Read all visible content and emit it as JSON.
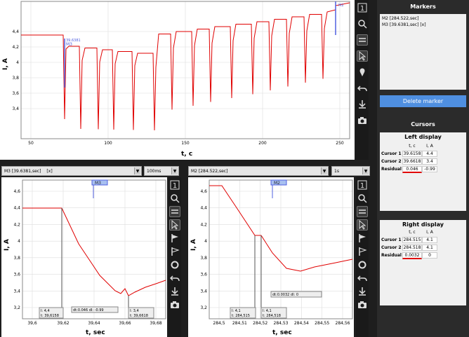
{
  "top_plot": {
    "ylabel": "I, A",
    "xlabel": "t, c",
    "yticks": [
      "4,4",
      "4,2",
      "4",
      "3,8",
      "3,6",
      "3,4"
    ],
    "xticks": [
      "50",
      "100",
      "150",
      "200",
      "250"
    ],
    "marker_labels": [
      "M3",
      "M2"
    ],
    "marker_values": [
      "39.6381",
      "284.522"
    ]
  },
  "bottom_left": {
    "select_marker": "M3 [39.6381,sec]",
    "select_x": "[x]",
    "select_window": "100ms",
    "ylabel": "I, A",
    "xlabel": "t, sec",
    "yticks": [
      "4,6",
      "4,4",
      "4,2",
      "4",
      "3,8",
      "3,6",
      "3,4",
      "3,2"
    ],
    "xticks": [
      "39,6",
      "39,62",
      "39,64",
      "39,66",
      "39,68"
    ],
    "marker_tag": "M3",
    "cursor1_text_i": "I:     4,4",
    "cursor1_text_t": "t:  39,6158",
    "cursor2_text_i": "I:     3,4",
    "cursor2_text_t": "t:  39,6618",
    "delta_text": "dt:0.046  dI:  -0.99"
  },
  "bottom_right": {
    "select_marker": "M2 [284.522,sec]",
    "select_window": "1s",
    "ylabel": "I, A",
    "xlabel": "t, sec",
    "yticks": [
      "4,6",
      "4,4",
      "4,2",
      "4",
      "3,8",
      "3,6",
      "3,4",
      "3,2"
    ],
    "xticks": [
      "284,5",
      "284,51",
      "284,52",
      "284,53",
      "284,54",
      "284,55",
      "284,56"
    ],
    "marker_tag": "M2",
    "cursor1_text_i": "I:     4,1",
    "cursor1_text_t": "t:  284,515",
    "cursor2_text_i": "I:     4,1",
    "cursor2_text_t": "t:  284,518",
    "delta_text": "dt:0.0032  dI:      0"
  },
  "toolbar_icons": [
    "number-1-icon",
    "zoom-icon",
    "swap-icon",
    "pointer-icon",
    "pin-icon",
    "undo-icon",
    "download-icon",
    "camera-icon"
  ],
  "toolbar_icons_bottom": [
    "number-1-icon",
    "zoom-icon",
    "swap-icon",
    "pointer-icon",
    "flag-icon",
    "flag-outline-icon",
    "ring-icon",
    "undo-icon",
    "download-icon",
    "camera-icon"
  ],
  "right_panel": {
    "markers_title": "Markers",
    "markers": [
      "M2 [284.522,sec]",
      "M3 [39.6381,sec]    [x]"
    ],
    "delete_button": "Delete marker",
    "cursors_title": "Cursors",
    "left_display_title": "Left display",
    "right_display_title": "Right display",
    "table_headers": [
      "t, c",
      "I, A"
    ],
    "left_rows": [
      {
        "name": "Cursor 1",
        "t": "39.6158",
        "i": "4.4"
      },
      {
        "name": "Cursor 2",
        "t": "39.6618",
        "i": "3.4"
      },
      {
        "name": "Residual",
        "t": "0.046",
        "i": "-0.99"
      }
    ],
    "right_rows": [
      {
        "name": "Cursor 1",
        "t": "284.515",
        "i": "4.1"
      },
      {
        "name": "Cursor 2",
        "t": "284.518",
        "i": "4.1"
      },
      {
        "name": "Residual",
        "t": "0.0032",
        "i": "0"
      }
    ],
    "accent_color": "#4f8fe0",
    "residual_underline_color": "#e00000"
  },
  "colors": {
    "signal": "#e00000",
    "marker": "#5060e0",
    "grid": "#dddddd"
  }
}
